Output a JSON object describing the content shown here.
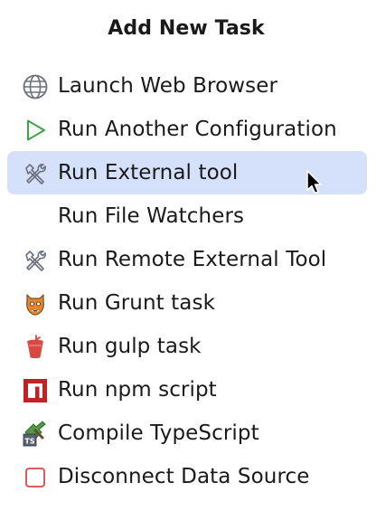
{
  "popup": {
    "title": "Add New Task"
  },
  "items": [
    {
      "label": "Launch Web Browser",
      "icon": "globe-icon"
    },
    {
      "label": "Run Another Configuration",
      "icon": "run-play-icon"
    },
    {
      "label": "Run External tool",
      "icon": "tools-icon",
      "selected": true
    },
    {
      "label": "Run File Watchers",
      "icon": ""
    },
    {
      "label": "Run Remote External Tool",
      "icon": "tools-icon"
    },
    {
      "label": "Run Grunt task",
      "icon": "grunt-icon"
    },
    {
      "label": "Run gulp task",
      "icon": "gulp-icon"
    },
    {
      "label": "Run npm script",
      "icon": "npm-icon"
    },
    {
      "label": "Compile TypeScript",
      "icon": "typescript-icon"
    },
    {
      "label": "Disconnect Data Source",
      "icon": "data-source-icon"
    }
  ],
  "colors": {
    "selection": "#d5e1fb",
    "run_green": "#3fa34d",
    "gulp_red": "#d84a41",
    "npm_red": "#c12127",
    "grunt_orange": "#e48632",
    "data_source_red": "#d7484f"
  }
}
